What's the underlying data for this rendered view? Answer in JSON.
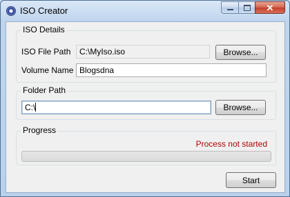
{
  "window": {
    "title": "ISO Creator",
    "controls": {
      "minimize_icon": "minimize-icon",
      "maximize_icon": "maximize-icon",
      "close_glyph": "✕"
    }
  },
  "iso_details": {
    "group_title": "ISO Details",
    "file_path_label": "ISO File Path",
    "file_path_value": "C:\\MyIso.iso",
    "browse_label": "Browse...",
    "volume_name_label": "Volume Name",
    "volume_name_value": "Blogsdna"
  },
  "folder_path": {
    "group_title": "Folder Path",
    "value": "C:\\",
    "browse_label": "Browse..."
  },
  "progress": {
    "group_title": "Progress",
    "status": "Process not started",
    "status_color": "#b30000",
    "value": 0
  },
  "start_button": {
    "label": "Start"
  }
}
